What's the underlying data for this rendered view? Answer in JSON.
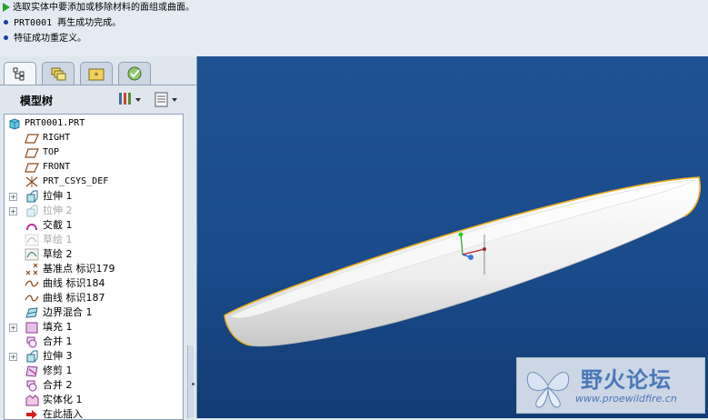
{
  "messages": [
    {
      "type": "prompt",
      "text": "选取实体中要添加或移除材料的面组或曲面。"
    },
    {
      "type": "info",
      "text": "PRT0001 再生成功完成。"
    },
    {
      "type": "info",
      "text": "特征成功重定义。"
    }
  ],
  "navigator": {
    "tabs": [
      "model-tree-tab",
      "layer-tree-tab",
      "favorites-tab",
      "history-tab"
    ],
    "tree_title": "模型树"
  },
  "tree": [
    {
      "label": "PRT0001.PRT",
      "icon": "part-icon",
      "grey": false,
      "expander": false
    },
    {
      "label": "RIGHT",
      "icon": "datum-plane-icon",
      "grey": false,
      "expander": false
    },
    {
      "label": "TOP",
      "icon": "datum-plane-icon",
      "grey": false,
      "expander": false
    },
    {
      "label": "FRONT",
      "icon": "datum-plane-icon",
      "grey": false,
      "expander": false
    },
    {
      "label": "PRT_CSYS_DEF",
      "icon": "csys-icon",
      "grey": false,
      "expander": false
    },
    {
      "label": "拉伸 1",
      "icon": "extrude-icon",
      "grey": false,
      "expander": true
    },
    {
      "label": "拉伸 2",
      "icon": "extrude-icon",
      "grey": true,
      "expander": true
    },
    {
      "label": "交截 1",
      "icon": "intersect-icon",
      "grey": false,
      "expander": false
    },
    {
      "label": "草绘 1",
      "icon": "sketch-icon",
      "grey": true,
      "expander": false
    },
    {
      "label": "草绘 2",
      "icon": "sketch-icon",
      "grey": false,
      "expander": false
    },
    {
      "label": "基准点 标识179",
      "icon": "datum-point-icon",
      "grey": false,
      "expander": false
    },
    {
      "label": "曲线 标识184",
      "icon": "curve-icon",
      "grey": false,
      "expander": false
    },
    {
      "label": "曲线 标识187",
      "icon": "curve-icon",
      "grey": false,
      "expander": false
    },
    {
      "label": "边界混合 1",
      "icon": "boundary-blend-icon",
      "grey": false,
      "expander": false
    },
    {
      "label": "填充 1",
      "icon": "fill-icon",
      "grey": false,
      "expander": true
    },
    {
      "label": "合并 1",
      "icon": "merge-icon",
      "grey": false,
      "expander": false
    },
    {
      "label": "拉伸 3",
      "icon": "extrude-icon",
      "grey": false,
      "expander": true
    },
    {
      "label": "修剪 1",
      "icon": "trim-icon",
      "grey": false,
      "expander": false
    },
    {
      "label": "合并 2",
      "icon": "merge-icon",
      "grey": false,
      "expander": false
    },
    {
      "label": "实体化 1",
      "icon": "solidify-icon",
      "grey": false,
      "expander": false
    },
    {
      "label": "在此插入",
      "icon": "insert-here-icon",
      "grey": false,
      "expander": false
    }
  ],
  "watermark": {
    "title": "野火论坛",
    "url": "www.proewildfire.cn"
  },
  "colors": {
    "viewport_top": "#1f5292",
    "viewport_bottom": "#123c74",
    "edge_highlight": "#f0b020",
    "insert_arrow": "#d42020"
  }
}
